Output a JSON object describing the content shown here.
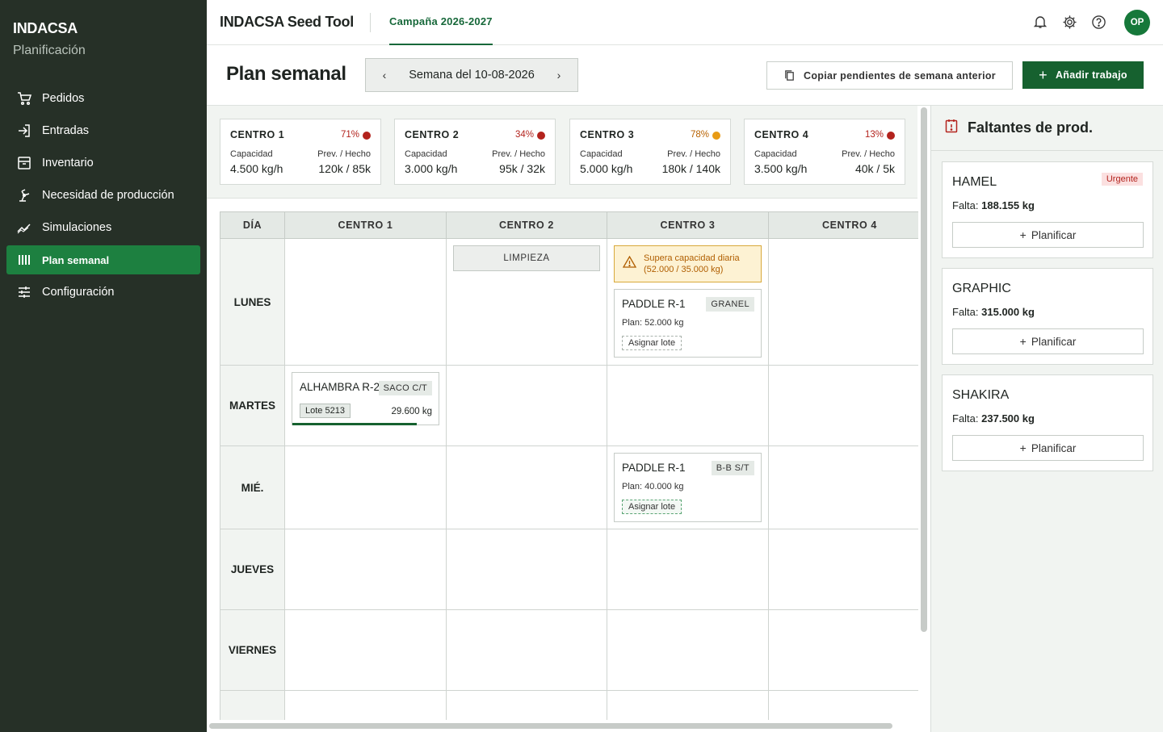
{
  "sidebar": {
    "brand": "INDACSA",
    "subtitle": "Planificación",
    "items": [
      {
        "label": "Pedidos",
        "icon": "cart-icon"
      },
      {
        "label": "Entradas",
        "icon": "login-icon"
      },
      {
        "label": "Inventario",
        "icon": "archive-icon"
      },
      {
        "label": "Necesidad de producción",
        "icon": "robot-arm-icon"
      },
      {
        "label": "Simulaciones",
        "icon": "trend-icon"
      },
      {
        "label": "Plan semanal",
        "icon": "columns-icon",
        "active": true
      },
      {
        "label": "Configuración",
        "icon": "sliders-icon"
      }
    ]
  },
  "topbar": {
    "app_title": "INDACSA Seed Tool",
    "campaign_tab": "Campaña 2026-2027",
    "avatar_initials": "OP"
  },
  "header": {
    "title": "Plan semanal",
    "week_label": "Semana del 10-08-2026",
    "copy_button": "Copiar pendientes de semana anterior",
    "add_button": "Añadir trabajo"
  },
  "centers": [
    {
      "name": "CENTRO 1",
      "pct": "71%",
      "status_color": "#b3231d",
      "capacity_label": "Capacidad",
      "capacity": "4.500 kg/h",
      "prev_label": "Prev. / Hecho",
      "prev": "120k / 85k"
    },
    {
      "name": "CENTRO 2",
      "pct": "34%",
      "status_color": "#b3231d",
      "capacity_label": "Capacidad",
      "capacity": "3.000 kg/h",
      "prev_label": "Prev. / Hecho",
      "prev": "95k / 32k"
    },
    {
      "name": "CENTRO 3",
      "pct": "78%",
      "status_color": "#e89b15",
      "capacity_label": "Capacidad",
      "capacity": "5.000 kg/h",
      "prev_label": "Prev. / Hecho",
      "prev": "180k / 140k"
    },
    {
      "name": "CENTRO 4",
      "pct": "13%",
      "status_color": "#b3231d",
      "capacity_label": "Capacidad",
      "capacity": "3.500 kg/h",
      "prev_label": "Prev. / Hecho",
      "prev": "40k / 5k"
    }
  ],
  "grid": {
    "headers": [
      "DÍA",
      "CENTRO 1",
      "CENTRO 2",
      "CENTRO 3",
      "CENTRO 4"
    ],
    "days": [
      "LUNES",
      "MARTES",
      "MIÉ.",
      "JUEVES",
      "VIERNES"
    ],
    "limpieza": "LIMPIEZA",
    "warning": "Supera capacidad diaria (52.000 / 35.000 kg)",
    "job_lunes": {
      "name": "PADDLE R-1",
      "tag": "GRANEL",
      "plan": "Plan: 52.000 kg",
      "assign": "Asignar lote"
    },
    "job_martes": {
      "name": "ALHAMBRA R-2",
      "tag": "SACO C/T",
      "lote": "Lote 5213",
      "kg": "29.600 kg",
      "progress": 0.85
    },
    "job_mie": {
      "name": "PADDLE R-1",
      "tag": "B-B S/T",
      "plan": "Plan: 40.000 kg",
      "assign": "Asignar lote"
    }
  },
  "shortages": {
    "title": "Faltantes de prod.",
    "items": [
      {
        "name": "HAMEL",
        "badge": "Urgente",
        "falta_label": "Falta:",
        "falta": "188.155 kg",
        "button": "Planificar"
      },
      {
        "name": "GRAPHIC",
        "falta_label": "Falta:",
        "falta": "315.000 kg",
        "button": "Planificar"
      },
      {
        "name": "SHAKIRA",
        "falta_label": "Falta:",
        "falta": "237.500 kg",
        "button": "Planificar"
      }
    ]
  }
}
